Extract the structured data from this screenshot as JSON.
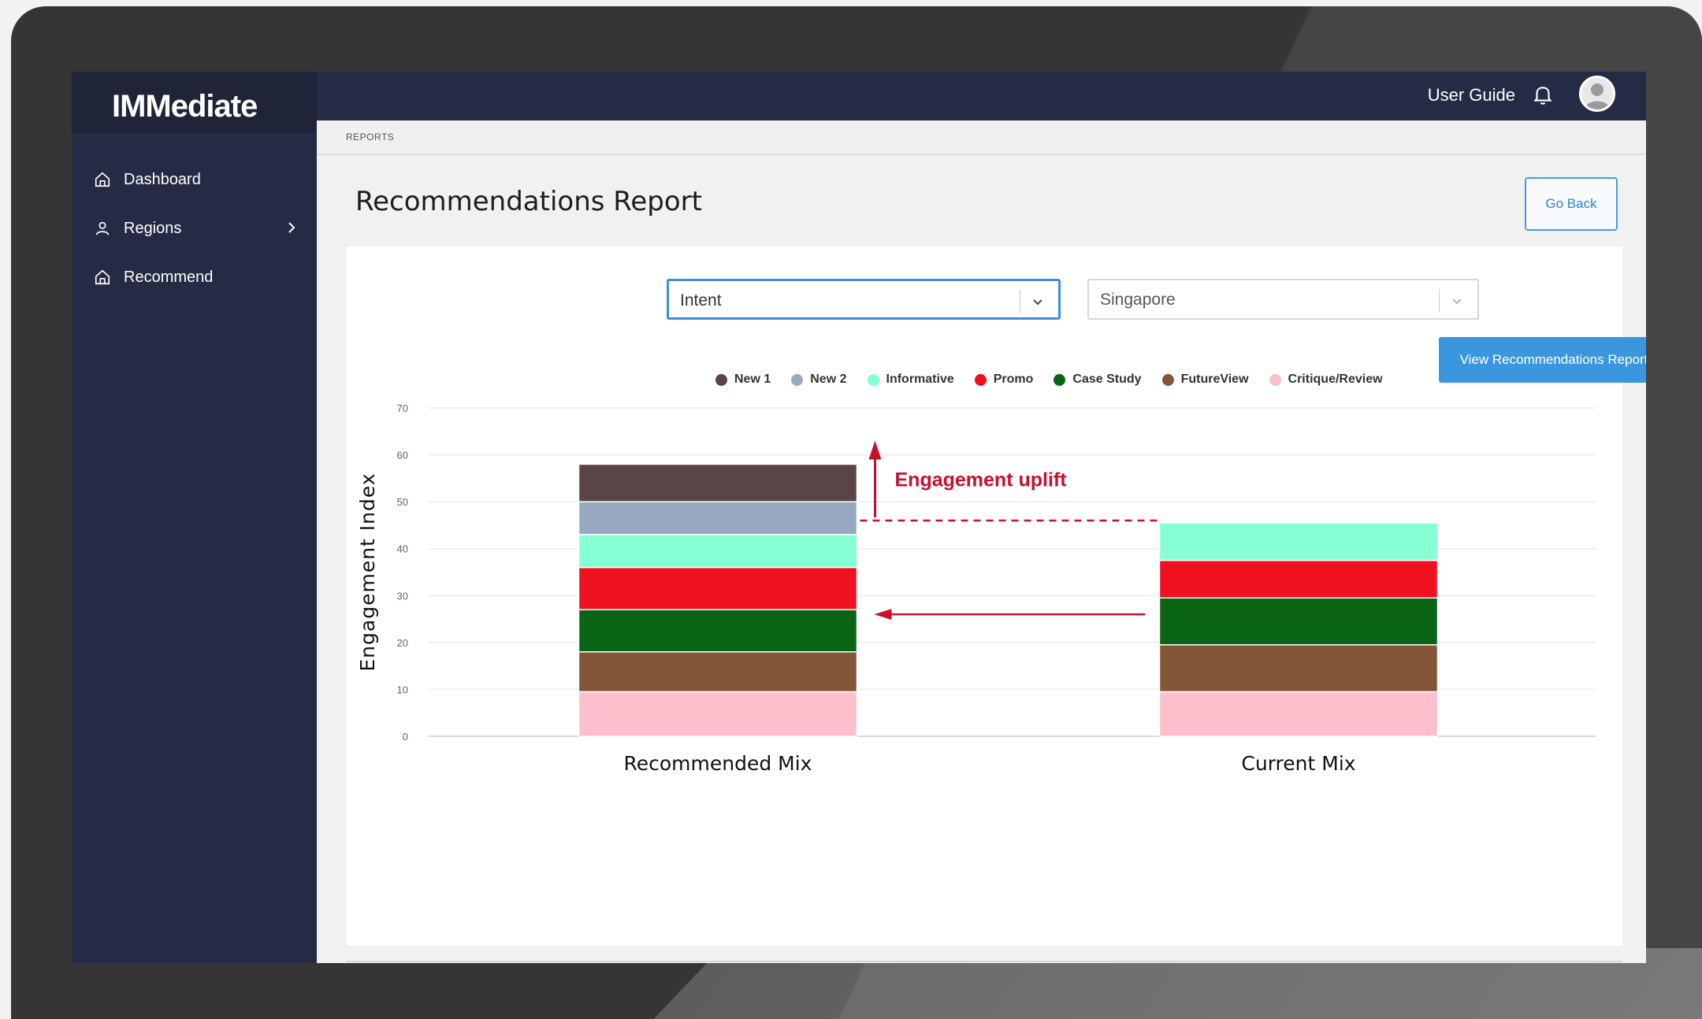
{
  "app": {
    "logo": "IMMediate"
  },
  "sidebar": {
    "items": [
      {
        "label": "Dashboard",
        "icon": "home-icon"
      },
      {
        "label": "Regions",
        "icon": "user-icon",
        "has_submenu": true
      },
      {
        "label": "Recommend",
        "icon": "home-icon"
      }
    ]
  },
  "topbar": {
    "user_guide": "User Guide"
  },
  "breadcrumb": "REPORTS",
  "page": {
    "title": "Recommendations Report",
    "go_back": "Go Back"
  },
  "filters": {
    "intent": {
      "value": "Intent"
    },
    "country": {
      "value": "Singapore"
    },
    "view_button": "View Recommendations Report"
  },
  "colors": {
    "accent": "#3a97dd",
    "sidebar": "#262b45",
    "annotation": "#c8102e"
  },
  "chart_data": {
    "type": "bar",
    "stacked": true,
    "ylabel": "Engagement Index",
    "ylim": [
      0,
      70
    ],
    "yticks": [
      0,
      10,
      20,
      30,
      40,
      50,
      60,
      70
    ],
    "grid": true,
    "legend_position": "top",
    "categories": [
      "Recommended Mix",
      "Current Mix"
    ],
    "series": [
      {
        "name": "Critique/Review",
        "color": "#fdbfcc",
        "values": [
          9.5,
          9.5
        ]
      },
      {
        "name": "FutureView",
        "color": "#835637",
        "values": [
          8.5,
          10
        ]
      },
      {
        "name": "Case Study",
        "color": "#0a6415",
        "values": [
          9,
          10
        ]
      },
      {
        "name": "Promo",
        "color": "#ef1020",
        "values": [
          9,
          8
        ]
      },
      {
        "name": "Informative",
        "color": "#85ffd3",
        "values": [
          7,
          8
        ]
      },
      {
        "name": "New 2",
        "color": "#96a9c0",
        "values": [
          7,
          0
        ]
      },
      {
        "name": "New 1",
        "color": "#5b4446",
        "values": [
          8,
          0
        ]
      }
    ],
    "legend_order": [
      "New 1",
      "New 2",
      "Informative",
      "Promo",
      "Case Study",
      "FutureView",
      "Critique/Review"
    ],
    "annotations": {
      "uplift_label": "Engagement uplift"
    }
  }
}
